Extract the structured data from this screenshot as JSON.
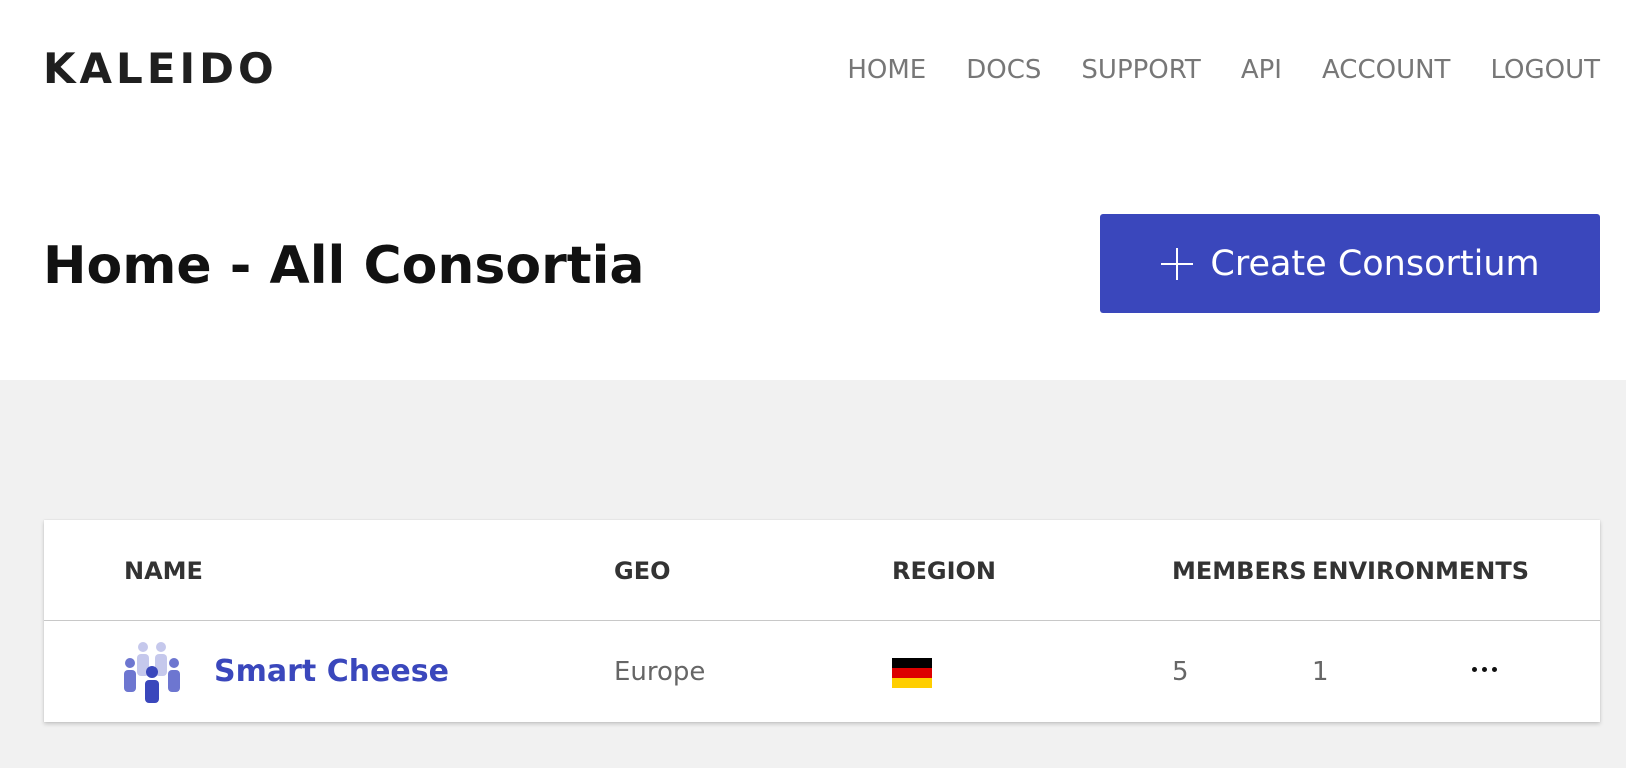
{
  "header": {
    "logo": "KALEIDO",
    "nav": [
      "HOME",
      "DOCS",
      "SUPPORT",
      "API",
      "ACCOUNT",
      "LOGOUT"
    ]
  },
  "page": {
    "title": "Home - All Consortia",
    "create_button_label": "Create Consortium",
    "create_button_icon": "plus-icon"
  },
  "table": {
    "columns": {
      "name": "NAME",
      "geo": "GEO",
      "region": "REGION",
      "members": "MEMBERS",
      "environments": "ENVIRONMENTS"
    },
    "rows": [
      {
        "icon": "people-group-icon",
        "name": "Smart Cheese",
        "geo": "Europe",
        "region_flag": "germany-flag-icon",
        "members": "5",
        "environments": "1",
        "actions_icon": "more-horizontal-icon"
      }
    ]
  },
  "colors": {
    "accent": "#3a47bc",
    "background": "#f1f1f1",
    "nav_text": "#777777",
    "flag_black": "#000000",
    "flag_red": "#dd0000",
    "flag_gold": "#ffce00"
  }
}
